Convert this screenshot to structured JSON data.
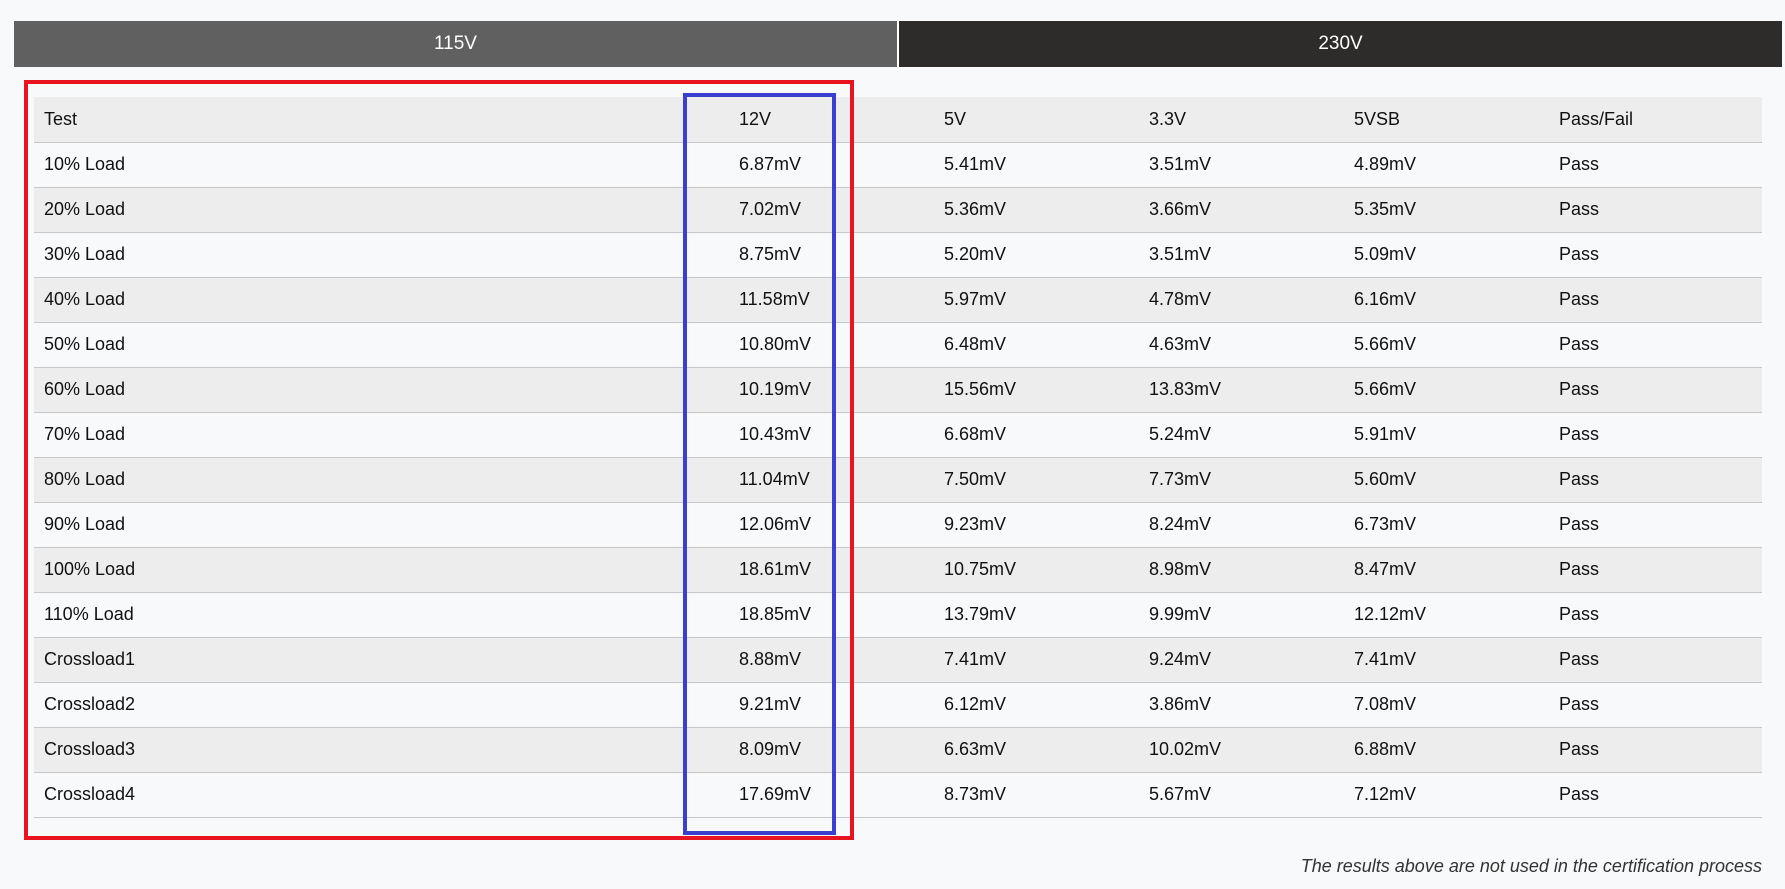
{
  "tabs": [
    {
      "label": "115V"
    },
    {
      "label": "230V"
    }
  ],
  "table": {
    "headers": [
      "Test",
      "12V",
      "5V",
      "3.3V",
      "5VSB",
      "Pass/Fail"
    ],
    "rows": [
      [
        "10% Load",
        "6.87mV",
        "5.41mV",
        "3.51mV",
        "4.89mV",
        "Pass"
      ],
      [
        "20% Load",
        "7.02mV",
        "5.36mV",
        "3.66mV",
        "5.35mV",
        "Pass"
      ],
      [
        "30% Load",
        "8.75mV",
        "5.20mV",
        "3.51mV",
        "5.09mV",
        "Pass"
      ],
      [
        "40% Load",
        "11.58mV",
        "5.97mV",
        "4.78mV",
        "6.16mV",
        "Pass"
      ],
      [
        "50% Load",
        "10.80mV",
        "6.48mV",
        "4.63mV",
        "5.66mV",
        "Pass"
      ],
      [
        "60% Load",
        "10.19mV",
        "15.56mV",
        "13.83mV",
        "5.66mV",
        "Pass"
      ],
      [
        "70% Load",
        "10.43mV",
        "6.68mV",
        "5.24mV",
        "5.91mV",
        "Pass"
      ],
      [
        "80% Load",
        "11.04mV",
        "7.50mV",
        "7.73mV",
        "5.60mV",
        "Pass"
      ],
      [
        "90% Load",
        "12.06mV",
        "9.23mV",
        "8.24mV",
        "6.73mV",
        "Pass"
      ],
      [
        "100% Load",
        "18.61mV",
        "10.75mV",
        "8.98mV",
        "8.47mV",
        "Pass"
      ],
      [
        "110% Load",
        "18.85mV",
        "13.79mV",
        "9.99mV",
        "12.12mV",
        "Pass"
      ],
      [
        "Crossload1",
        "8.88mV",
        "7.41mV",
        "9.24mV",
        "7.41mV",
        "Pass"
      ],
      [
        "Crossload2",
        "9.21mV",
        "6.12mV",
        "3.86mV",
        "7.08mV",
        "Pass"
      ],
      [
        "Crossload3",
        "8.09mV",
        "6.63mV",
        "10.02mV",
        "6.88mV",
        "Pass"
      ],
      [
        "Crossload4",
        "17.69mV",
        "8.73mV",
        "5.67mV",
        "7.12mV",
        "Pass"
      ]
    ]
  },
  "note": "The results above are not used in the certification process",
  "colors": {
    "tab_115_bg": "#606060",
    "tab_230_bg": "#2e2c2a",
    "highlight_red": "#e8141f",
    "highlight_blue": "#3b3fcf"
  }
}
